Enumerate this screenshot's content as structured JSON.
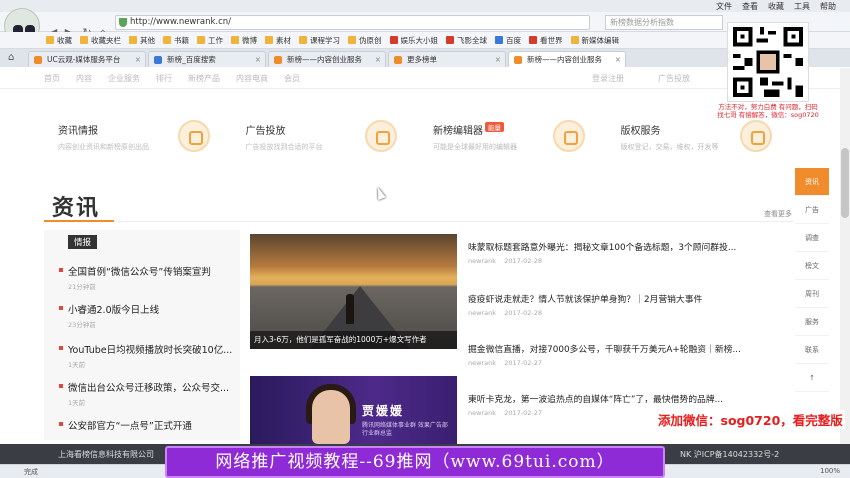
{
  "browser": {
    "menu": [
      "文件",
      "查看",
      "收藏",
      "工具",
      "帮助"
    ],
    "url": "http://www.newrank.cn/",
    "search_placeholder": "新榜数据分析指数",
    "bookmarks": [
      {
        "label": "收藏",
        "icon": "star-icon"
      },
      {
        "label": "收藏夹栏",
        "icon": "folder-icon"
      },
      {
        "label": "其他",
        "icon": "folder-icon"
      },
      {
        "label": "书籍",
        "icon": "folder-icon"
      },
      {
        "label": "工作",
        "icon": "folder-icon"
      },
      {
        "label": "微博",
        "icon": "folder-icon"
      },
      {
        "label": "素材",
        "icon": "folder-icon"
      },
      {
        "label": "课程学习",
        "icon": "folder-icon"
      },
      {
        "label": "伪原创",
        "icon": "folder-icon"
      },
      {
        "label": "娱乐大小姐",
        "icon": "toutiao-icon"
      },
      {
        "label": "飞影全球",
        "icon": "toutiao-icon"
      },
      {
        "label": "百度",
        "icon": "baidu-icon"
      },
      {
        "label": "看世界",
        "icon": "toutiao-icon"
      },
      {
        "label": "新媒体编辑",
        "icon": "page-icon"
      }
    ],
    "tabs": [
      {
        "label": "UC云观-媒体服务平台",
        "active": false
      },
      {
        "label": "新榜_百度搜索",
        "active": false
      },
      {
        "label": "新榜——内容创业服务",
        "active": false
      },
      {
        "label": "更多榜单",
        "active": false
      },
      {
        "label": "新榜——内容创业服务",
        "active": true
      }
    ]
  },
  "site": {
    "nav_left": [
      "首页",
      "内容",
      "企业服务",
      "排行",
      "新榜产品",
      "内容电商",
      "会员"
    ],
    "nav_right": [
      "登录注册",
      "广告投放"
    ],
    "cards": [
      {
        "title": "资讯情报",
        "subtitle": "内容创业资讯和新榜原创出品",
        "tag": ""
      },
      {
        "title": "广告投放",
        "subtitle": "广告投放找到合适的平台",
        "tag": ""
      },
      {
        "title": "新榜编辑器",
        "subtitle": "可能是全球最好用的编辑器",
        "tag": "能量"
      },
      {
        "title": "版权服务",
        "subtitle": "版权登记，交易，维权，开发等",
        "tag": ""
      }
    ],
    "section_title": "资讯",
    "more_label": "查看更多 >",
    "badge": "情报",
    "briefs": [
      {
        "title": "全国首例“微信公众号”传销案宣判",
        "time": "21分钟前"
      },
      {
        "title": "小睿通2.0版今日上线",
        "time": "23分钟前"
      },
      {
        "title": "YouTube日均视频播放时长突破10亿...",
        "time": "1天前"
      },
      {
        "title": "微信出台公众号迁移政策，公众号交...",
        "time": "1天前"
      },
      {
        "title": "公安部官方“一点号”正式开通",
        "time": ""
      }
    ],
    "feature1_caption": "月入3-6万，他们是孤军奋战的1000万+爆文写作者",
    "feature2_name": "贾媛媛",
    "feature2_sub": "腾讯网络媒体事业群 效果广告部行业群总监",
    "articles": [
      {
        "title": "味蒙取标题套路意外曝光：揭秘文章100个备选标题，3个顾问群投...",
        "author": "newrank",
        "date": "2017-02-28"
      },
      {
        "title": "疫疫虾说走就走？情人节就该保护单身狗？｜2月营销大事件",
        "author": "newrank",
        "date": "2017-02-28"
      },
      {
        "title": "掘金微信直播，对接7000多公号，千聊获千万美元A+轮融资｜新榜...",
        "author": "newrank",
        "date": "2017-02-27"
      },
      {
        "title": "東听卡克龙，第一波追热点的自媒体“阵亡”了，最快借势的品牌...",
        "author": "newrank",
        "date": "2017-02-27"
      }
    ],
    "sidebar": [
      "资讯",
      "广告",
      "调查",
      "榜文",
      "周刊",
      "服务",
      "联系",
      "↑"
    ],
    "footer_left": "上海看榜信息科技有限公司",
    "footer_right": "NK 沪ICP备14042332号-2"
  },
  "status": {
    "left": "完成",
    "right": "100%"
  },
  "overlays": {
    "qr_caption": "方法不对，努力白费 有问题，扫码找七哥 有偿解答，微信：sog0720",
    "red_text": "添加微信：sog0720，看完整版",
    "banner": "网络推广视频教程--69推网（www.69tui.com）"
  }
}
